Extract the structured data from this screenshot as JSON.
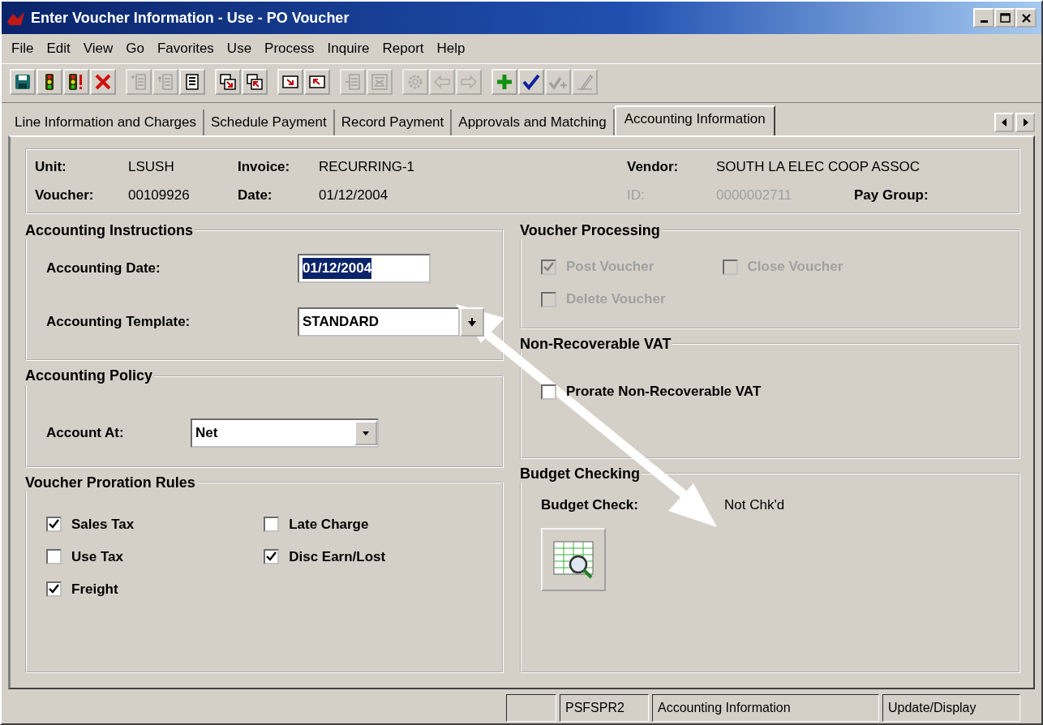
{
  "window": {
    "title": "Enter Voucher Information - Use - PO Voucher",
    "controls": [
      {
        "kind": "minimize"
      },
      {
        "kind": "maximize"
      },
      {
        "kind": "close"
      }
    ]
  },
  "menu": [
    "File",
    "Edit",
    "View",
    "Go",
    "Favorites",
    "Use",
    "Process",
    "Inquire",
    "Report",
    "Help"
  ],
  "toolbar": [
    [
      {
        "kind": "save",
        "disabled": false
      },
      {
        "kind": "light",
        "disabled": false
      },
      {
        "kind": "light-alert",
        "disabled": false
      },
      {
        "kind": "delete",
        "disabled": false
      }
    ],
    [
      {
        "kind": "insert-row",
        "disabled": true
      },
      {
        "kind": "insert-row-up",
        "disabled": true
      },
      {
        "kind": "list",
        "disabled": false
      }
    ],
    [
      {
        "kind": "window-down",
        "disabled": false
      },
      {
        "kind": "window-up",
        "disabled": false
      }
    ],
    [
      {
        "kind": "arrow-down-right",
        "disabled": false
      },
      {
        "kind": "arrow-up-left",
        "disabled": false
      }
    ],
    [
      {
        "kind": "lines",
        "disabled": true
      },
      {
        "kind": "grid",
        "disabled": true
      }
    ],
    [
      {
        "kind": "gear",
        "disabled": true
      },
      {
        "kind": "back",
        "disabled": true
      },
      {
        "kind": "forward",
        "disabled": true
      }
    ],
    [
      {
        "kind": "plus",
        "disabled": false
      },
      {
        "kind": "check",
        "disabled": false
      },
      {
        "kind": "check-plus",
        "disabled": true
      },
      {
        "kind": "pencil",
        "disabled": true
      }
    ]
  ],
  "tabs": [
    {
      "label": "Line Information and Charges",
      "selected": false
    },
    {
      "label": "Schedule Payment",
      "selected": false
    },
    {
      "label": "Record Payment",
      "selected": false
    },
    {
      "label": "Approvals and Matching",
      "selected": false
    },
    {
      "label": "Accounting Information",
      "selected": true
    }
  ],
  "header": [
    {
      "label": "Unit:",
      "value": "LSUSH",
      "disabled": false
    },
    {
      "label": "Invoice:",
      "value": "RECURRING-1",
      "disabled": false
    },
    {
      "label": "Vendor:",
      "value": "SOUTH LA ELEC COOP ASSOC",
      "disabled": false
    },
    {
      "label": "Voucher:",
      "value": "00109926",
      "disabled": false
    },
    {
      "label": "Date:",
      "value": "01/12/2004",
      "disabled": false
    },
    {
      "label": "ID:",
      "value": "0000002711",
      "disabled": true
    },
    {
      "label": "Pay Group:",
      "disabled": false
    }
  ],
  "accounting_instructions": {
    "title": "Accounting Instructions",
    "date": {
      "label": "Accounting Date:",
      "value": "01/12/2004",
      "selected": true
    },
    "template": {
      "label": "Accounting Template:",
      "value": "STANDARD"
    }
  },
  "accounting_policy": {
    "title": "Accounting Policy",
    "label": "Account At:",
    "value": "Net"
  },
  "proration": {
    "title": "Voucher Proration Rules",
    "columns": [
      [
        {
          "label": "Sales Tax",
          "checked": true,
          "disabled": false
        },
        {
          "label": "Use Tax",
          "checked": false,
          "disabled": false
        },
        {
          "label": "Freight",
          "checked": true,
          "disabled": false
        }
      ],
      [
        {
          "label": "Late Charge",
          "checked": false,
          "disabled": false
        },
        {
          "label": "Disc Earn/Lost",
          "checked": true,
          "disabled": false
        }
      ]
    ]
  },
  "voucher_processing": {
    "title": "Voucher Processing",
    "columns": [
      [
        {
          "label": "Post Voucher",
          "checked": true,
          "disabled": true
        },
        {
          "label": "Delete Voucher",
          "checked": false,
          "disabled": true
        }
      ],
      [
        {
          "label": "Close Voucher",
          "checked": false,
          "disabled": true
        }
      ]
    ]
  },
  "vat": {
    "title": "Non-Recoverable VAT",
    "columns": [
      [
        {
          "label": "Prorate Non-Recoverable VAT",
          "checked": false,
          "disabled": false
        }
      ]
    ]
  },
  "budget": {
    "title": "Budget Checking",
    "label": "Budget Check:",
    "value": "Not Chk'd"
  },
  "status_bar": [
    "PSFSPR2",
    "Accounting Information",
    "Update/Display"
  ]
}
